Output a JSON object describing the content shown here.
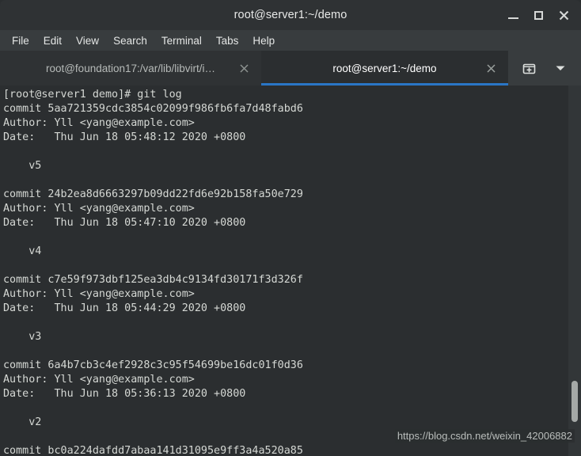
{
  "window": {
    "title": "root@server1:~/demo",
    "controls": {
      "minimize": "minimize",
      "maximize": "maximize",
      "close": "close"
    }
  },
  "menubar": {
    "items": [
      {
        "label": "File"
      },
      {
        "label": "Edit"
      },
      {
        "label": "View"
      },
      {
        "label": "Search"
      },
      {
        "label": "Terminal"
      },
      {
        "label": "Tabs"
      },
      {
        "label": "Help"
      }
    ]
  },
  "tabbar": {
    "tabs": [
      {
        "label": "root@foundation17:/var/lib/libvirt/i…",
        "active": false,
        "close_label": "×"
      },
      {
        "label": "root@server1:~/demo",
        "active": true,
        "close_label": "×"
      }
    ],
    "new_tab_icon": "new-tab-icon",
    "tab_menu_icon": "chevron-down-icon"
  },
  "terminal": {
    "prompt_line": "[root@server1 demo]# git log",
    "content": "[root@server1 demo]# git log\ncommit 5aa721359cdc3854c02099f986fb6fa7d48fabd6\nAuthor: Yll <yang@example.com>\nDate:   Thu Jun 18 05:48:12 2020 +0800\n\n    v5\n\ncommit 24b2ea8d6663297b09dd22fd6e92b158fa50e729\nAuthor: Yll <yang@example.com>\nDate:   Thu Jun 18 05:47:10 2020 +0800\n\n    v4\n\ncommit c7e59f973dbf125ea3db4c9134fd30171f3d326f\nAuthor: Yll <yang@example.com>\nDate:   Thu Jun 18 05:44:29 2020 +0800\n\n    v3\n\ncommit 6a4b7cb3c4ef2928c3c95f54699be16dc01f0d36\nAuthor: Yll <yang@example.com>\nDate:   Thu Jun 18 05:36:13 2020 +0800\n\n    v2\n\ncommit bc0a224dafdd7abaa141d31095e9ff3a4a520a85",
    "commits": [
      {
        "commit": "commit 5aa721359cdc3854c02099f986fb6fa7d48fabd6",
        "hash": "5aa721359cdc3854c02099f986fb6fa7d48fabd6",
        "author": "Author: Yll <yang@example.com>",
        "date": "Date:   Thu Jun 18 05:48:12 2020 +0800",
        "message": "v5"
      },
      {
        "commit": "commit 24b2ea8d6663297b09dd22fd6e92b158fa50e729",
        "hash": "24b2ea8d6663297b09dd22fd6e92b158fa50e729",
        "author": "Author: Yll <yang@example.com>",
        "date": "Date:   Thu Jun 18 05:47:10 2020 +0800",
        "message": "v4"
      },
      {
        "commit": "commit c7e59f973dbf125ea3db4c9134fd30171f3d326f",
        "hash": "c7e59f973dbf125ea3db4c9134fd30171f3d326f",
        "author": "Author: Yll <yang@example.com>",
        "date": "Date:   Thu Jun 18 05:44:29 2020 +0800",
        "message": "v3"
      },
      {
        "commit": "commit 6a4b7cb3c4ef2928c3c95f54699be16dc01f0d36",
        "hash": "6a4b7cb3c4ef2928c3c95f54699be16dc01f0d36",
        "author": "Author: Yll <yang@example.com>",
        "date": "Date:   Thu Jun 18 05:36:13 2020 +0800",
        "message": "v2"
      },
      {
        "commit": "commit bc0a224dafdd7abaa141d31095e9ff3a4a520a85",
        "hash": "bc0a224dafdd7abaa141d31095e9ff3a4a520a85",
        "author": "",
        "date": "",
        "message": ""
      }
    ]
  },
  "scrollbar": {
    "name": "vertical-scrollbar"
  },
  "watermark": {
    "text": "https://blog.csdn.net/weixin_42006882"
  },
  "colors": {
    "titlebar_bg": "#2f3234",
    "menubar_bg": "#383c3e",
    "terminal_bg": "#2b2e30",
    "terminal_fg": "#d5d8d4",
    "active_tab_accent": "#2a76c6",
    "scroll_thumb": "#a5a9a7"
  }
}
